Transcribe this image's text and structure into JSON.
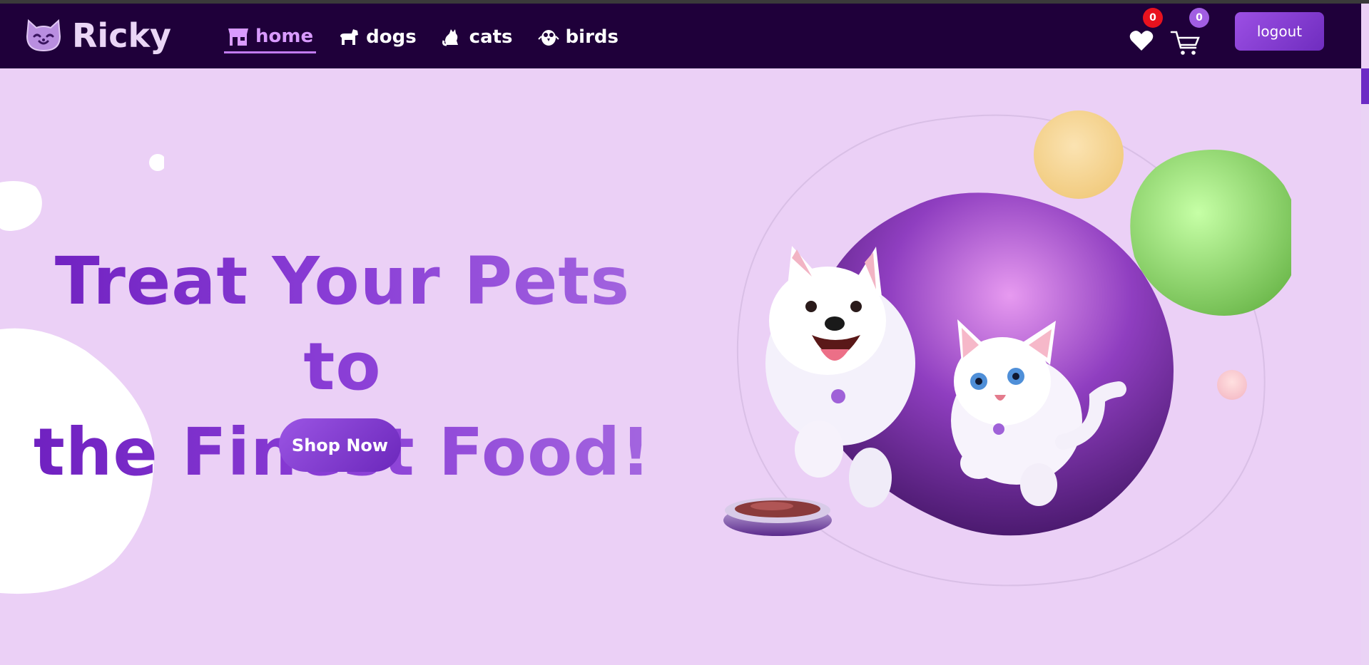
{
  "brand": {
    "name": "Ricky",
    "logo_icon": "cat-face-icon"
  },
  "nav": {
    "items": [
      {
        "label": "home",
        "icon": "store-icon",
        "active": true
      },
      {
        "label": "dogs",
        "icon": "dog-icon",
        "active": false
      },
      {
        "label": "cats",
        "icon": "cat-icon",
        "active": false
      },
      {
        "label": "birds",
        "icon": "bird-icon",
        "active": false
      }
    ]
  },
  "header": {
    "favorites_count": "0",
    "cart_count": "0",
    "logout_label": "logout"
  },
  "hero": {
    "title_line1": "Treat Your Pets to",
    "title_line2": "the Finest Food!",
    "cta_label": "Shop Now"
  },
  "colors": {
    "navbar_bg": "#1f003a",
    "page_bg": "#ebd0f6",
    "accent": "#8a3ed6",
    "badge_red": "#e8121e",
    "badge_purple": "#a15ee2"
  }
}
